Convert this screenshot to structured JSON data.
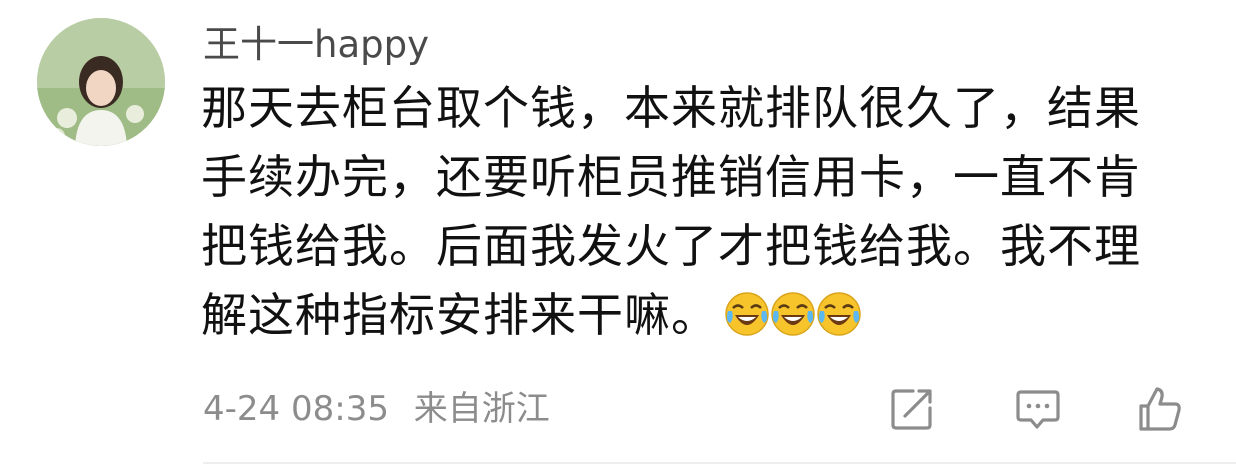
{
  "comment": {
    "username": "王十一happy",
    "text_lines": [
      "那天去柜台取个钱，本来就排队很久了，结果",
      "手续办完，还要听柜员推销信用卡，一直不肯",
      "把钱给我。后面我发火了才把钱给我。我不理",
      "解这种指标安排来干嘛。"
    ],
    "emojis": [
      "laugh-cry-emoji",
      "laugh-cry-emoji",
      "laugh-cry-emoji"
    ],
    "timestamp": "4-24 08:35",
    "location": "来自浙江"
  },
  "actions": [
    {
      "name": "share-icon"
    },
    {
      "name": "reply-comment-icon"
    },
    {
      "name": "like-thumbs-up-icon"
    }
  ],
  "colors": {
    "username": "#4a4a4a",
    "body": "#111111",
    "meta": "#8c8c8c",
    "icon": "#8c8c8c",
    "emoji_face": "#f7c52b"
  }
}
